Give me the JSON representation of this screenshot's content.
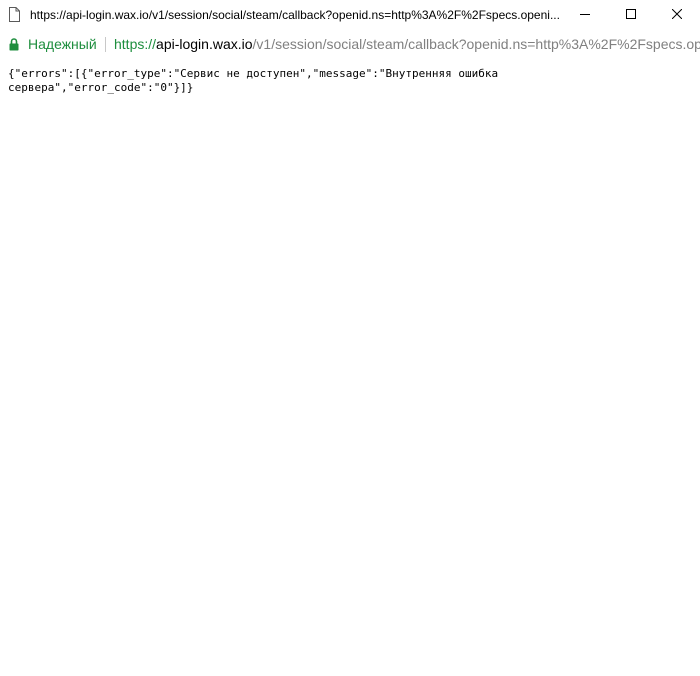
{
  "window": {
    "title": "https://api-login.wax.io/v1/session/social/steam/callback?openid.ns=http%3A%2F%2Fspecs.openi..."
  },
  "icons": {
    "page": "page-icon",
    "minimize": "minimize-icon",
    "maximize": "maximize-icon",
    "close": "close-icon",
    "lock": "lock-icon"
  },
  "colors": {
    "secure": "#1e8e3e",
    "url_path": "#808080"
  },
  "addressbar": {
    "secure_label": "Надежный",
    "url_scheme": "https://",
    "url_host": "api-login.wax.io",
    "url_path": "/v1/session/social/steam/callback?openid.ns=http%3A%2F%2Fspecs.op"
  },
  "content": {
    "body_text": "{\"errors\":[{\"error_type\":\"Сервис не доступен\",\"message\":\"Внутренняя ошибка сервера\",\"error_code\":\"0\"}]}"
  }
}
